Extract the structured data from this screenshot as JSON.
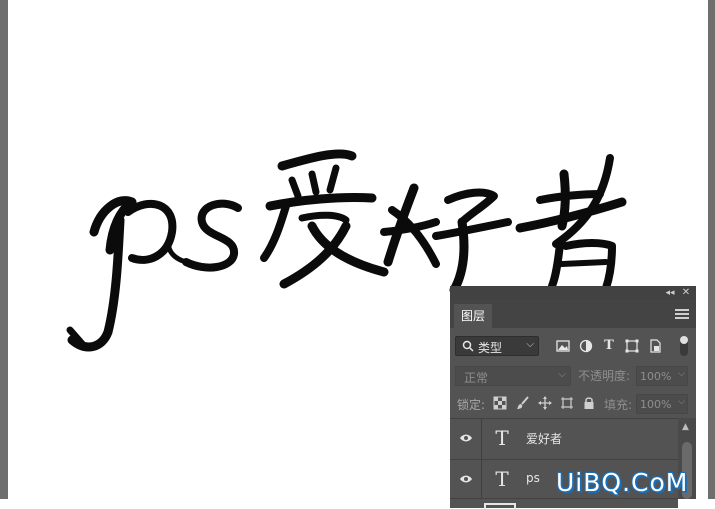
{
  "colors": {
    "panel_bg": "#535353",
    "panel_dark": "#424242",
    "text": "#e6e6e6",
    "muted": "#8e8e8e",
    "watermark": "#1b6fb8"
  },
  "canvas": {
    "artwork_text": "ps爱好者"
  },
  "layers_panel": {
    "tab_label": "图层",
    "filter": {
      "icon": "search-icon",
      "label": "类型",
      "chevron": "⌵"
    },
    "filter_icons": [
      "pixel-layer-icon",
      "adjustment-layer-icon",
      "type-layer-icon",
      "shape-layer-icon",
      "smart-object-icon"
    ],
    "type_glyph": "T",
    "blend_mode": "正常",
    "opacity_label": "不透明度:",
    "opacity_value": "100%",
    "lock_label": "锁定:",
    "fill_label": "填充:",
    "fill_value": "100%",
    "layers": [
      {
        "name": "爱好者",
        "kind": "text",
        "visible": true,
        "glyph": "T"
      },
      {
        "name": "ps",
        "kind": "text",
        "visible": true,
        "glyph": "T"
      }
    ],
    "collapse_glyph": "◂◂",
    "close_glyph": "✕",
    "chevron_glyph": "⌵",
    "scroll_up_glyph": "▲"
  },
  "watermark": "UiBQ.CoM"
}
